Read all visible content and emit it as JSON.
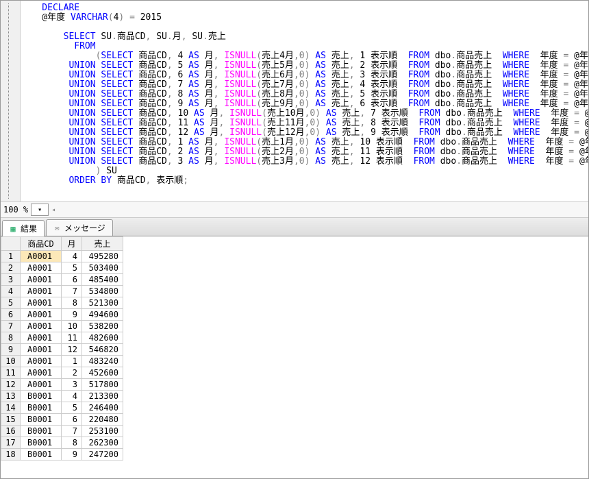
{
  "zoom": {
    "value": "100 %"
  },
  "tabs": {
    "results": "結果",
    "messages": "メッセージ"
  },
  "headers": {
    "rownum": "",
    "prod": "商品CD",
    "month": "月",
    "sales": "売上"
  },
  "sql": {
    "l01": "    DECLARE",
    "l02_a": "    @年度 ",
    "l02_b": "VARCHAR",
    "l02_c": "(",
    "l02_d": "4",
    "l02_e": ")",
    "l02_f": " = ",
    "l02_g": "2015",
    "l03": "",
    "l04_a": "        SELECT ",
    "l04_b": "SU",
    "l04_c": ".",
    "l04_d": "商品CD",
    "l04_e": ", ",
    "l04_f": "SU",
    "l04_g": ".",
    "l04_h": "月",
    "l04_i": ", ",
    "l04_j": "SU",
    "l04_k": ".",
    "l04_l": "売上",
    "l05": "          FROM",
    "line_template": {
      "indent1": "              (SELECT ",
      "indent2": "         UNION SELECT ",
      "prod": "商品CD",
      "comma1": ", ",
      "as": " AS ",
      "month_lbl": "月",
      "comma2": ", ",
      "isnull": "ISNULL",
      "open": "(",
      "col_prefix": "売上",
      "col_suffix": "月",
      "zero": ",0",
      "close": ")",
      "as2": " AS ",
      "sales": "売上",
      "comma3": ", ",
      "disp": " 表示順  ",
      "from": "FROM ",
      "dbo": "dbo",
      "dot": ".",
      "tbl": "商品売上  ",
      "where": "WHERE  ",
      "nendo": "年度 ",
      "eq": "= ",
      "at": "@年度"
    },
    "rows": [
      {
        "first": true,
        "m": "4",
        "d": "1"
      },
      {
        "first": false,
        "m": "5",
        "d": "2"
      },
      {
        "first": false,
        "m": "6",
        "d": "3"
      },
      {
        "first": false,
        "m": "7",
        "d": "4"
      },
      {
        "first": false,
        "m": "8",
        "d": "5"
      },
      {
        "first": false,
        "m": "9",
        "d": "6"
      },
      {
        "first": false,
        "m": "10",
        "d": "7"
      },
      {
        "first": false,
        "m": "11",
        "d": "8"
      },
      {
        "first": false,
        "m": "12",
        "d": "9"
      },
      {
        "first": false,
        "m": "1",
        "d": "10"
      },
      {
        "first": false,
        "m": "2",
        "d": "11"
      },
      {
        "first": false,
        "m": "3",
        "d": "12"
      }
    ],
    "l_close": "              ) SU",
    "l_order_a": "         ORDER BY ",
    "l_order_b": "商品CD",
    "l_order_c": ", ",
    "l_order_d": "表示順",
    "l_order_e": ";"
  },
  "results": [
    {
      "n": "1",
      "p": "A0001",
      "m": "4",
      "s": "495280"
    },
    {
      "n": "2",
      "p": "A0001",
      "m": "5",
      "s": "503400"
    },
    {
      "n": "3",
      "p": "A0001",
      "m": "6",
      "s": "485400"
    },
    {
      "n": "4",
      "p": "A0001",
      "m": "7",
      "s": "534800"
    },
    {
      "n": "5",
      "p": "A0001",
      "m": "8",
      "s": "521300"
    },
    {
      "n": "6",
      "p": "A0001",
      "m": "9",
      "s": "494600"
    },
    {
      "n": "7",
      "p": "A0001",
      "m": "10",
      "s": "538200"
    },
    {
      "n": "8",
      "p": "A0001",
      "m": "11",
      "s": "482600"
    },
    {
      "n": "9",
      "p": "A0001",
      "m": "12",
      "s": "546820"
    },
    {
      "n": "10",
      "p": "A0001",
      "m": "1",
      "s": "483240"
    },
    {
      "n": "11",
      "p": "A0001",
      "m": "2",
      "s": "452600"
    },
    {
      "n": "12",
      "p": "A0001",
      "m": "3",
      "s": "517800"
    },
    {
      "n": "13",
      "p": "B0001",
      "m": "4",
      "s": "213300"
    },
    {
      "n": "14",
      "p": "B0001",
      "m": "5",
      "s": "246400"
    },
    {
      "n": "15",
      "p": "B0001",
      "m": "6",
      "s": "220480"
    },
    {
      "n": "16",
      "p": "B0001",
      "m": "7",
      "s": "253100"
    },
    {
      "n": "17",
      "p": "B0001",
      "m": "8",
      "s": "262300"
    },
    {
      "n": "18",
      "p": "B0001",
      "m": "9",
      "s": "247200"
    }
  ]
}
